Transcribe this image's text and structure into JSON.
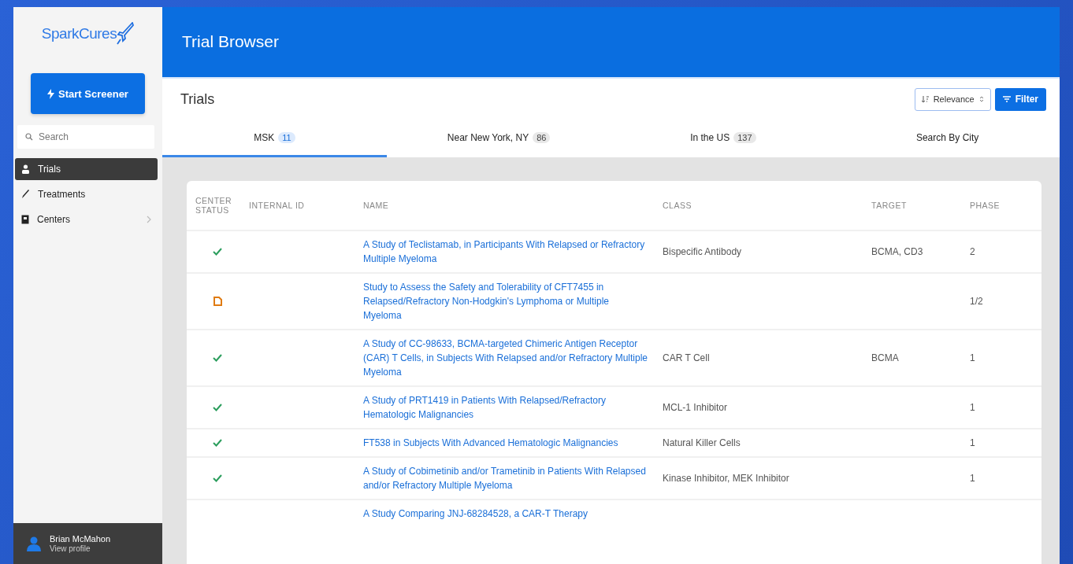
{
  "sidebar": {
    "logo": "SparkCures",
    "start_button": "Start Screener",
    "search": {
      "placeholder": "Search"
    },
    "items": [
      {
        "label": "Trials",
        "selected": true,
        "has_submenu": false
      },
      {
        "label": "Treatments",
        "selected": false,
        "has_submenu": false
      },
      {
        "label": "Centers",
        "selected": false,
        "has_submenu": true
      }
    ],
    "user": {
      "name": "Brian McMahon",
      "link": "View profile"
    }
  },
  "header": {
    "title": "Trial Browser"
  },
  "toolbar": {
    "title": "Trials",
    "sort": "Relevance",
    "filter_button": "Filter"
  },
  "tabs": [
    {
      "label": "MSK",
      "count": "11",
      "selected": true
    },
    {
      "label": "Near New York, NY",
      "count": "86",
      "selected": false
    },
    {
      "label": "In the US",
      "count": "137",
      "selected": false
    },
    {
      "label": "Search By City",
      "selected": false
    }
  ],
  "table": {
    "columns": [
      "CENTER STATUS",
      "INTERNAL ID",
      "NAME",
      "CLASS",
      "TARGET",
      "PHASE"
    ],
    "rows": [
      {
        "pending": false,
        "name": "A Study of Teclistamab, in Participants With Relapsed or Refractory Multiple Myeloma",
        "class": "Bispecific Antibody",
        "target": "BCMA, CD3",
        "phase": "2"
      },
      {
        "pending": true,
        "name": "Study to Assess the Safety and Tolerability of CFT7455 in Relapsed/Refractory Non-Hodgkin's Lymphoma or Multiple Myeloma",
        "phase": "1/2"
      },
      {
        "pending": false,
        "name": "A Study of CC-98633, BCMA-targeted Chimeric Antigen Receptor (CAR) T Cells, in Subjects With Relapsed and/or Refractory Multiple Myeloma",
        "class": "CAR T Cell",
        "target": "BCMA",
        "phase": "1"
      },
      {
        "pending": false,
        "name": "A Study of PRT1419 in Patients With Relapsed/Refractory Hematologic Malignancies",
        "class": "MCL-1 Inhibitor",
        "phase": "1"
      },
      {
        "pending": false,
        "name": "FT538 in Subjects With Advanced Hematologic Malignancies",
        "class": "Natural Killer Cells",
        "phase": "1"
      },
      {
        "pending": false,
        "name": "A Study of Cobimetinib and/or Trametinib in Patients With Relapsed and/or Refractory Multiple Myeloma",
        "class": "Kinase Inhibitor, MEK Inhibitor",
        "phase": "1"
      },
      {
        "name": "A Study Comparing JNJ-68284528, a CAR-T Therapy"
      }
    ]
  }
}
